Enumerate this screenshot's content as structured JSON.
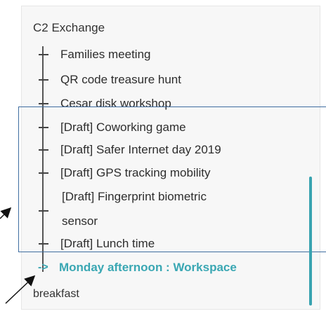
{
  "header": {
    "title": "C2 Exchange"
  },
  "tree": {
    "items": [
      {
        "label": "Families meeting"
      },
      {
        "label": "QR code treasure hunt"
      },
      {
        "label": "Cesar disk workshop"
      },
      {
        "label": "[Draft] Coworking game"
      },
      {
        "label": "[Draft] Safer Internet day 2019"
      },
      {
        "label": "[Draft] GPS tracking mobility"
      },
      {
        "label": "[Draft] Fingerprint biometric",
        "continuation": "sensor"
      },
      {
        "label": "[Draft] Lunch time"
      }
    ],
    "active_item": {
      "label": "Monday afternoon : Workspace",
      "icon": "arrow-right-icon"
    }
  },
  "footer": {
    "label": "breakfast"
  },
  "colors": {
    "accent": "#3aa7b3",
    "highlight_border": "#3f6da0",
    "text": "#2d2d2d"
  }
}
